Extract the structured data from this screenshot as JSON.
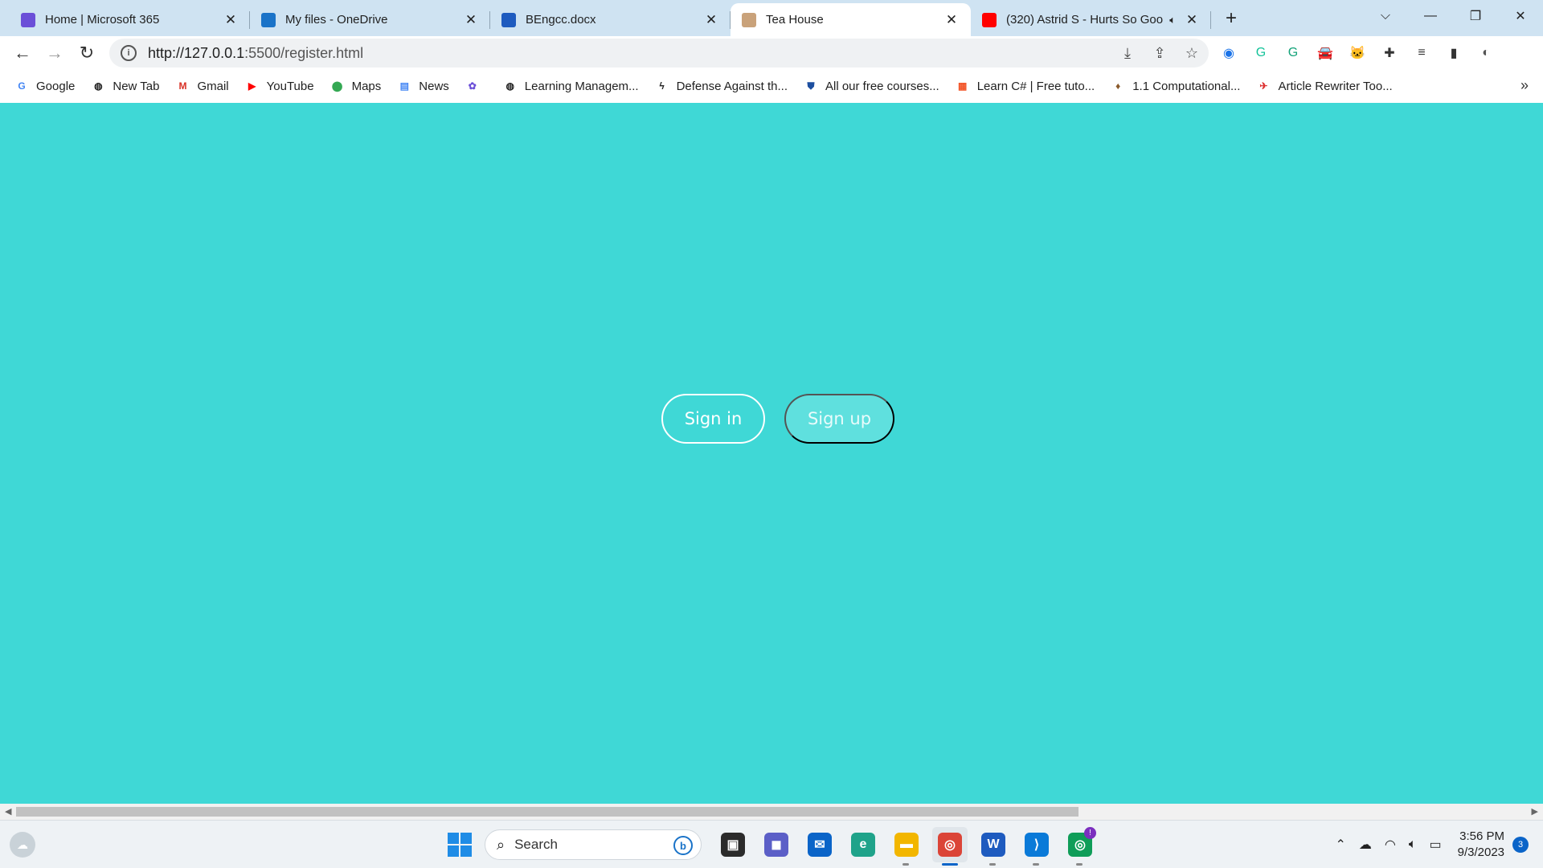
{
  "browser": {
    "tabs": [
      {
        "title": "Home | Microsoft 365",
        "icon": "microsoft-365-icon",
        "icon_color": "#6b4fd8",
        "active": false
      },
      {
        "title": "My files - OneDrive",
        "icon": "onedrive-cloud-icon",
        "icon_color": "#1a73c8",
        "active": false
      },
      {
        "title": "BEngcc.docx",
        "icon": "word-doc-icon",
        "icon_color": "#1e5bbf",
        "active": false
      },
      {
        "title": "Tea House",
        "icon": "tea-house-favicon",
        "icon_color": "#c9a27a",
        "active": true
      },
      {
        "title": "(320) Astrid S - Hurts So Goo",
        "icon": "youtube-icon",
        "icon_color": "#ff0000",
        "active": false,
        "audio": true
      }
    ],
    "new_tab_symbol": "+",
    "window_controls": [
      "⌵",
      "—",
      "❐",
      "✕"
    ],
    "url_host": "http://127.0.0.1",
    "url_rest": ":5500/register.html",
    "extensions": [
      {
        "name": "screencast-extension-icon",
        "glyph": "◉",
        "color": "#1a73e8"
      },
      {
        "name": "grammarly-extension-icon",
        "glyph": "G",
        "color": "#15c39a"
      },
      {
        "name": "grammarly-go-extension-icon",
        "glyph": "G",
        "color": "#15a37a"
      },
      {
        "name": "car-extension-icon",
        "glyph": "🚘",
        "color": "#c44"
      },
      {
        "name": "cat-extension-icon",
        "glyph": "🐱",
        "color": "#b47ad8"
      },
      {
        "name": "extensions-puzzle-icon",
        "glyph": "✚",
        "color": "#333"
      },
      {
        "name": "media-control-icon",
        "glyph": "≡",
        "color": "#333"
      },
      {
        "name": "side-panel-icon",
        "glyph": "▮",
        "color": "#333"
      },
      {
        "name": "profile-avatar-icon",
        "glyph": "◐",
        "color": "#555"
      }
    ],
    "bookmarks": [
      {
        "label": "Google",
        "icon": "google-icon",
        "glyph": "G",
        "color": "#4285f4"
      },
      {
        "label": "New Tab",
        "icon": "globe-icon",
        "glyph": "◍",
        "color": "#222"
      },
      {
        "label": "Gmail",
        "icon": "gmail-icon",
        "glyph": "M",
        "color": "#d93025"
      },
      {
        "label": "YouTube",
        "icon": "youtube-icon",
        "glyph": "▶",
        "color": "#ff0000"
      },
      {
        "label": "Maps",
        "icon": "maps-pin-icon",
        "glyph": "⬤",
        "color": "#34a853"
      },
      {
        "label": "News",
        "icon": "google-news-icon",
        "glyph": "▤",
        "color": "#4285f4"
      },
      {
        "label": "",
        "icon": "copilot-icon",
        "glyph": "✿",
        "color": "#6b4fd8"
      },
      {
        "label": "Learning Managem...",
        "icon": "globe-icon",
        "glyph": "◍",
        "color": "#222"
      },
      {
        "label": "Defense Against th...",
        "icon": "lightning-icon",
        "glyph": "ϟ",
        "color": "#222"
      },
      {
        "label": "All our free courses...",
        "icon": "shield-icon",
        "glyph": "⛊",
        "color": "#1d4fa0"
      },
      {
        "label": "Learn C# | Free tuto...",
        "icon": "microsoft-logo-icon",
        "glyph": "▦",
        "color": "#f25022"
      },
      {
        "label": "1.1 Computational...",
        "icon": "bookmark-site-icon",
        "glyph": "♦",
        "color": "#8a5a2b"
      },
      {
        "label": "Article Rewriter Too...",
        "icon": "rewriter-site-icon",
        "glyph": "✈",
        "color": "#d33"
      }
    ],
    "bookmarks_more": "»"
  },
  "page": {
    "background": "#3fd8d6",
    "sign_in_label": "Sign in",
    "sign_up_label": "Sign up"
  },
  "taskbar": {
    "search_label": "Search",
    "apps": [
      {
        "name": "task-view-icon",
        "glyph": "▣",
        "bg": "#2b2b2b",
        "running": false
      },
      {
        "name": "teams-chat-icon",
        "glyph": "◼",
        "bg": "#5b5fc7",
        "running": false
      },
      {
        "name": "mail-icon",
        "glyph": "✉",
        "bg": "#0a64c8",
        "running": false
      },
      {
        "name": "edge-icon",
        "glyph": "e",
        "bg": "#1fa38a",
        "running": false
      },
      {
        "name": "file-explorer-icon",
        "glyph": "▬",
        "bg": "#f2b600",
        "running": true
      },
      {
        "name": "chrome-icon",
        "glyph": "◎",
        "bg": "#db4437",
        "running": true,
        "active": true
      },
      {
        "name": "word-icon",
        "glyph": "W",
        "bg": "#1e5bbf",
        "running": true
      },
      {
        "name": "vscode-icon",
        "glyph": "⟩",
        "bg": "#0a7ad8",
        "running": true
      },
      {
        "name": "chrome-profile-icon",
        "glyph": "◎",
        "bg": "#0f9d58",
        "running": true,
        "badge": "!"
      }
    ],
    "time": "3:56 PM",
    "date": "9/3/2023",
    "notifications": "3"
  }
}
